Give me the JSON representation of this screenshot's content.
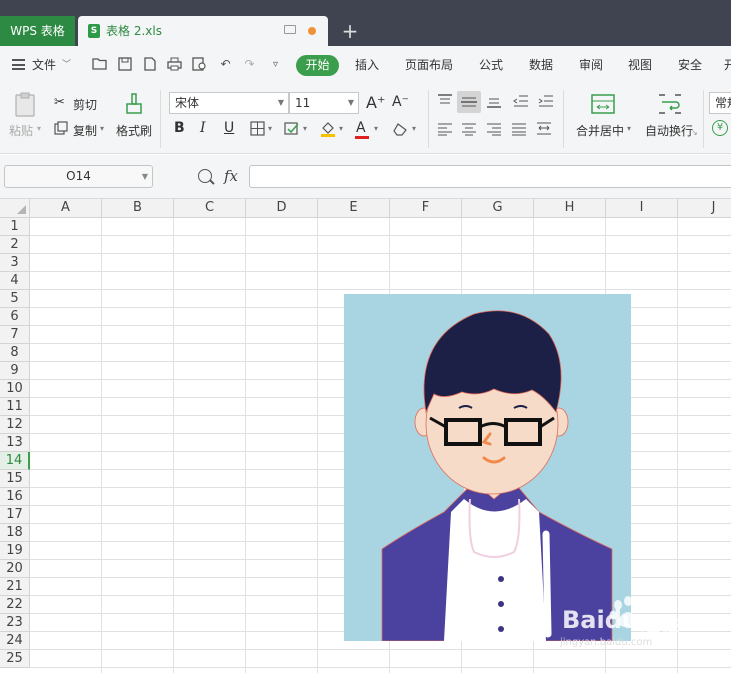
{
  "tabs": {
    "app_label": "WPS 表格",
    "doc_label": "表格 2.xls",
    "add_label": "+"
  },
  "menu": {
    "file_label": "文件",
    "items": [
      "开始",
      "插入",
      "页面布局",
      "公式",
      "数据",
      "审阅",
      "视图",
      "安全",
      "开"
    ]
  },
  "ribbon": {
    "paste_label": "粘贴",
    "cut_label": "剪切",
    "copy_label": "复制",
    "format_painter_label": "格式刷",
    "font_name": "宋体",
    "font_size": "11",
    "bold_label": "B",
    "italic_label": "I",
    "underline_label": "U",
    "font_color_label": "A",
    "grow_font_label": "A⁺",
    "shrink_font_label": "A⁻",
    "merge_center_label": "合并居中",
    "wrap_text_label": "自动换行",
    "number_format_label": "常规"
  },
  "formula_bar": {
    "name_box": "O14",
    "fx_label": "fx",
    "formula": ""
  },
  "sheet": {
    "columns": [
      "A",
      "B",
      "C",
      "D",
      "E",
      "F",
      "G",
      "H",
      "I",
      "J"
    ],
    "rows": [
      "1",
      "2",
      "3",
      "4",
      "5",
      "6",
      "7",
      "8",
      "9",
      "10",
      "11",
      "12",
      "13",
      "14",
      "15",
      "16",
      "17",
      "18",
      "19",
      "20",
      "21",
      "22",
      "23",
      "24",
      "25"
    ],
    "active_row": "14"
  },
  "watermark": {
    "brand": "Baidu",
    "sub": "经验",
    "url": "jingyan.baidu.com"
  },
  "colors": {
    "accent_green": "#3a9e4c",
    "picture_background": "#a9d4e2",
    "jacket": "#4b42a0",
    "hair": "#1c2046"
  }
}
